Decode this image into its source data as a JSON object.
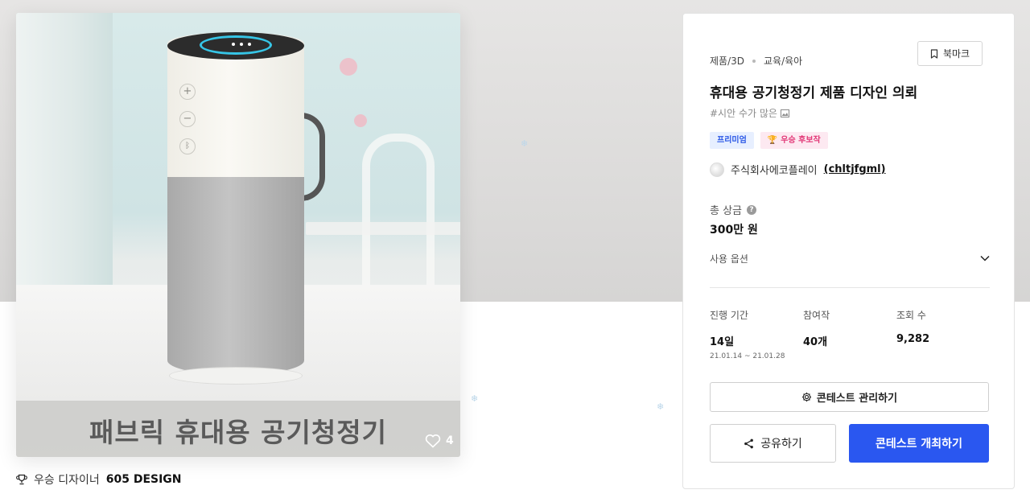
{
  "product_image": {
    "caption": "패브릭 휴대용 공기청정기",
    "like_count": "4"
  },
  "designer": {
    "prefix": "우승 디자이너",
    "name": "605 DESIGN"
  },
  "contest": {
    "breadcrumb": [
      "제품/3D",
      "교육/육아"
    ],
    "bookmark_label": "북마크",
    "title": "휴대용 공기청정기 제품 디자인 의뢰",
    "hashtag": "#시안 수가 많은",
    "badges": {
      "premium": "프리미엄",
      "winner": "우승 후보작"
    },
    "host": {
      "name": "주식회사에코플레이",
      "id": "(chltjfgml)"
    },
    "prize_label": "총 상금",
    "prize_value": "300만 원",
    "usage_label": "사용 옵션",
    "stats": {
      "period_label": "진행 기간",
      "period_value": "14일",
      "period_range": "21.01.14 ~ 21.01.28",
      "entries_label": "참여작",
      "entries_value": "40개",
      "views_label": "조회 수",
      "views_value": "9,282"
    },
    "manage_label": "콘테스트 관리하기",
    "share_label": "공유하기",
    "host_contest_label": "콘테스트 개최하기"
  },
  "colors": {
    "primary": "#2a57f0",
    "premium_badge": "#2a57e6",
    "winner_badge": "#e23877"
  },
  "icons": [
    "bookmark-icon",
    "help-icon",
    "chevron-down-icon",
    "gear-icon",
    "share-icon",
    "heart-icon",
    "trophy-icon"
  ]
}
